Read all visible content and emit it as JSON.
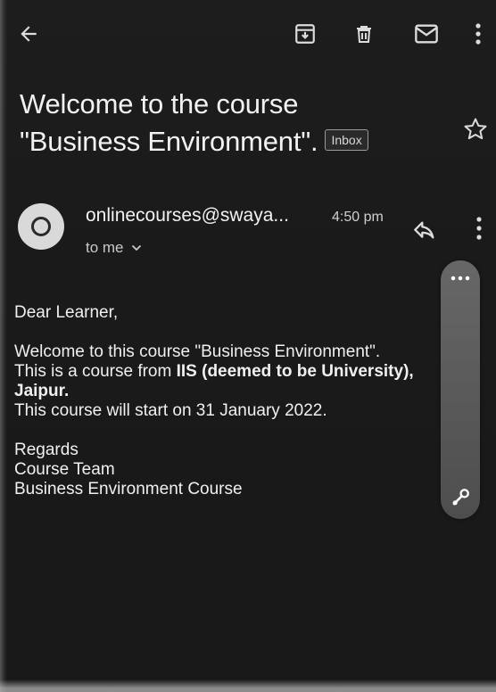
{
  "toolbar": {
    "icons": [
      "back-arrow-icon",
      "archive-icon",
      "delete-icon",
      "mark-unread-icon",
      "more-vert-icon"
    ]
  },
  "email": {
    "subject_line1": "Welcome to the course",
    "subject_line2": "\"Business Environment\".",
    "label": "Inbox",
    "sender": "onlinecourses@swaya...",
    "time": "4:50 pm",
    "recipient": "to me",
    "body": {
      "greeting": "Dear Learner,",
      "line1": "Welcome to this course \"Business Environment\".",
      "line2_prefix": "This is a course from ",
      "line2_bold": "IIS (deemed to be University),",
      "line3_bold": "Jaipur.",
      "line4": "This course will start on 31 January 2022.",
      "sign1": "Regards",
      "sign2": "Course Team",
      "sign3": "Business Environment Course"
    }
  },
  "colors": {
    "background": "#1a1a1a",
    "text": "#f0f0f0",
    "avatar": "#d9d9d9"
  }
}
